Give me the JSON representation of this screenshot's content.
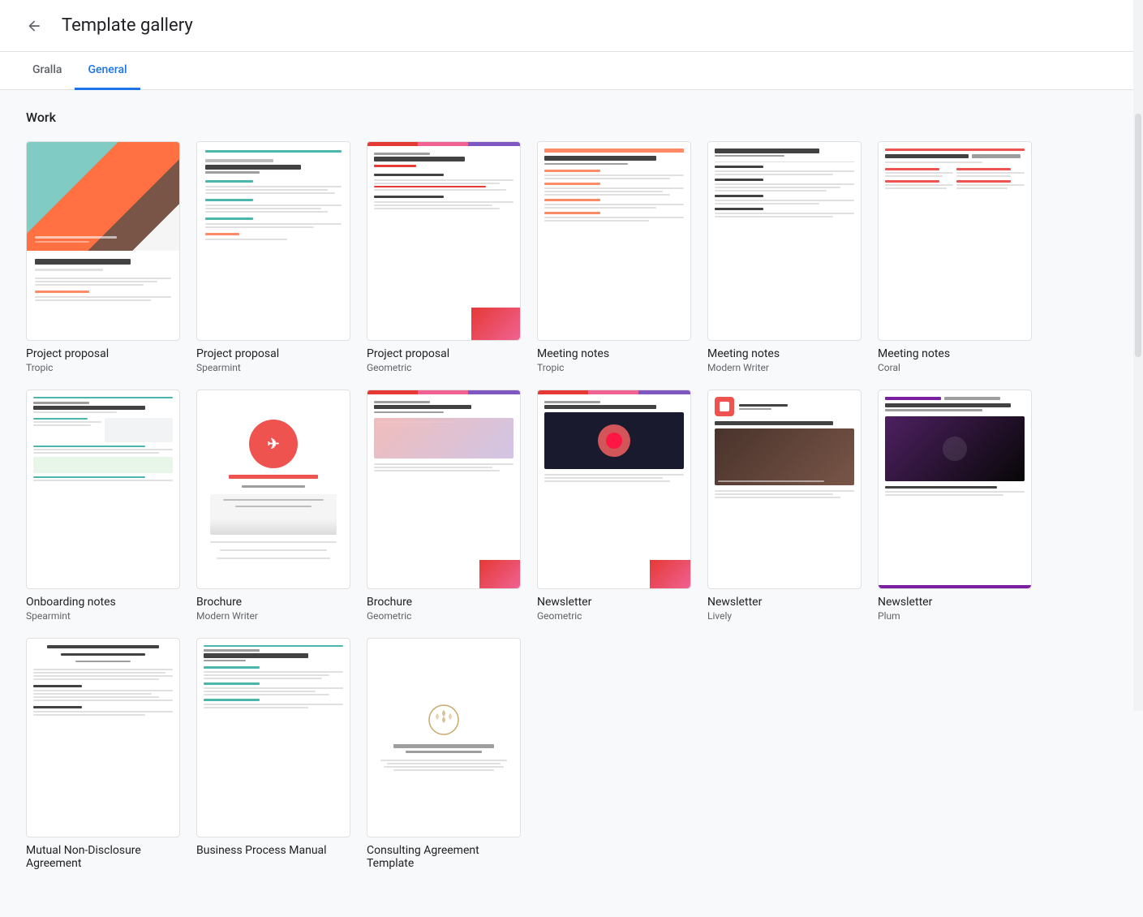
{
  "header": {
    "title": "Template gallery",
    "back_label": "Back"
  },
  "tabs": [
    {
      "id": "gralla",
      "label": "Gralla",
      "active": false
    },
    {
      "id": "general",
      "label": "General",
      "active": true
    }
  ],
  "sections": [
    {
      "id": "work",
      "title": "Work",
      "templates": [
        {
          "id": "pp-tropic",
          "name": "Project proposal",
          "sub": "Tropic",
          "style": "tropic"
        },
        {
          "id": "pp-spearmint",
          "name": "Project proposal",
          "sub": "Spearmint",
          "style": "spearmint"
        },
        {
          "id": "pp-geometric",
          "name": "Project proposal",
          "sub": "Geometric",
          "style": "geometric"
        },
        {
          "id": "mn-tropic",
          "name": "Meeting notes",
          "sub": "Tropic",
          "style": "mn-tropic"
        },
        {
          "id": "mn-modern",
          "name": "Meeting notes",
          "sub": "Modern Writer",
          "style": "mn-modern"
        },
        {
          "id": "mn-coral",
          "name": "Meeting notes",
          "sub": "Coral",
          "style": "mn-coral"
        },
        {
          "id": "on-spearmint",
          "name": "Onboarding notes",
          "sub": "Spearmint",
          "style": "on-spearmint"
        },
        {
          "id": "br-modern",
          "name": "Brochure",
          "sub": "Modern Writer",
          "style": "br-modern"
        },
        {
          "id": "br-geometric",
          "name": "Brochure",
          "sub": "Geometric",
          "style": "br-geometric"
        },
        {
          "id": "nl-geometric",
          "name": "Newsletter",
          "sub": "Geometric",
          "style": "nl-geometric"
        },
        {
          "id": "nl-lively",
          "name": "Newsletter",
          "sub": "Lively",
          "style": "nl-lively"
        },
        {
          "id": "nl-plum",
          "name": "Newsletter",
          "sub": "Plum",
          "style": "nl-plum"
        },
        {
          "id": "nda",
          "name": "Mutual Non-Disclosure Agreement",
          "sub": "",
          "style": "nda"
        },
        {
          "id": "bpm",
          "name": "Business Process Manual",
          "sub": "",
          "style": "bpm"
        },
        {
          "id": "ca",
          "name": "Consulting Agreement Template",
          "sub": "",
          "style": "ca"
        }
      ]
    }
  ]
}
